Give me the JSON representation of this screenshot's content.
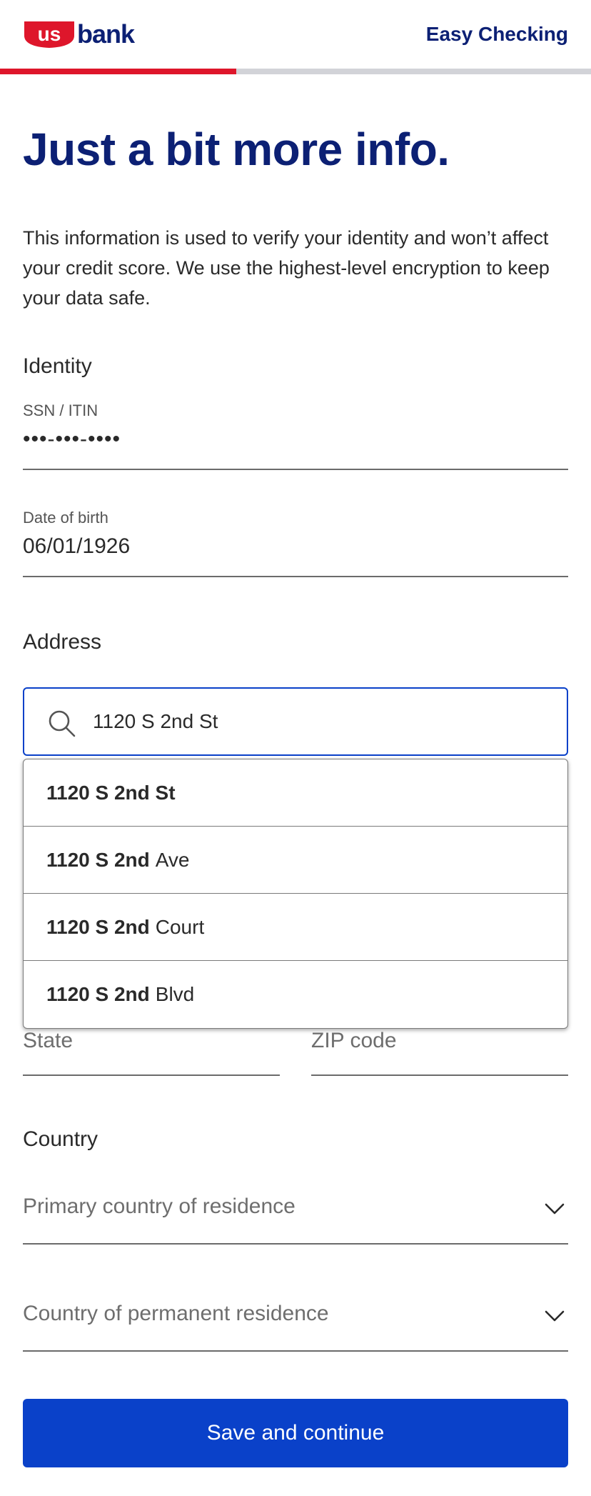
{
  "header": {
    "logo_text_left": "us",
    "logo_text_right": "bank",
    "product_name": "Easy Checking",
    "progress_fraction": 0.4
  },
  "title": "Just a bit more info.",
  "intro": "This information is used to verify your identity and won’t affect your credit score. We use the highest-level encryption to keep your data safe.",
  "identity": {
    "section_label": "Identity",
    "ssn_label": "SSN / ITIN",
    "ssn_value": "•••-•••-••••",
    "dob_label": "Date of birth",
    "dob_value": "06/01/1926"
  },
  "address": {
    "section_label": "Address",
    "search_value": "1120 S 2nd St",
    "suggestions": [
      {
        "match": "1120 S 2nd St",
        "rest": ""
      },
      {
        "match": "1120 S 2nd",
        "rest": "Ave"
      },
      {
        "match": "1120 S 2nd",
        "rest": "Court"
      },
      {
        "match": "1120 S 2nd",
        "rest": "Blvd"
      }
    ],
    "state_placeholder": "State",
    "zip_placeholder": "ZIP code"
  },
  "country": {
    "section_label": "Country",
    "primary_placeholder": "Primary country of residence",
    "permanent_placeholder": "Country of permanent residence"
  },
  "actions": {
    "submit_label": "Save and continue"
  },
  "colors": {
    "brand_navy": "#0c2074",
    "brand_red": "#de162b",
    "primary_blue": "#0a41c9"
  }
}
